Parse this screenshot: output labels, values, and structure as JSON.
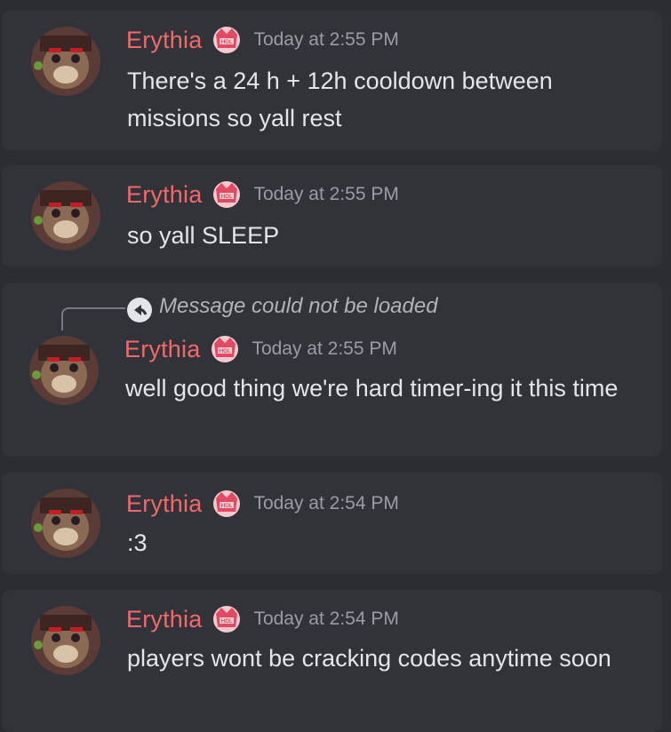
{
  "messages": [
    {
      "author": "Erythia",
      "timestamp": "Today at 2:55 PM",
      "text": "There's a 24 h + 12h cooldown between missions so yall rest"
    },
    {
      "author": "Erythia",
      "timestamp": "Today at 2:55 PM",
      "text": "so yall SLEEP"
    },
    {
      "author": "Erythia",
      "timestamp": "Today at 2:55 PM",
      "text": "well good thing we're hard timer-ing it this time",
      "reply_preview": "Message could not be loaded"
    },
    {
      "author": "Erythia",
      "timestamp": "Today at 2:54 PM",
      "text": ":3"
    },
    {
      "author": "Erythia",
      "timestamp": "Today at 2:54 PM",
      "text": "players wont be cracking codes anytime soon"
    }
  ],
  "colors": {
    "background": "#2b2d31",
    "message_bg": "#313338",
    "author": "#f2696b",
    "timestamp": "#9a9da4",
    "text": "#e3e5e8"
  },
  "icons": {
    "avatar": "avatar",
    "badge": "guild-tag-badge-icon",
    "reply": "reply-arrow-icon"
  }
}
